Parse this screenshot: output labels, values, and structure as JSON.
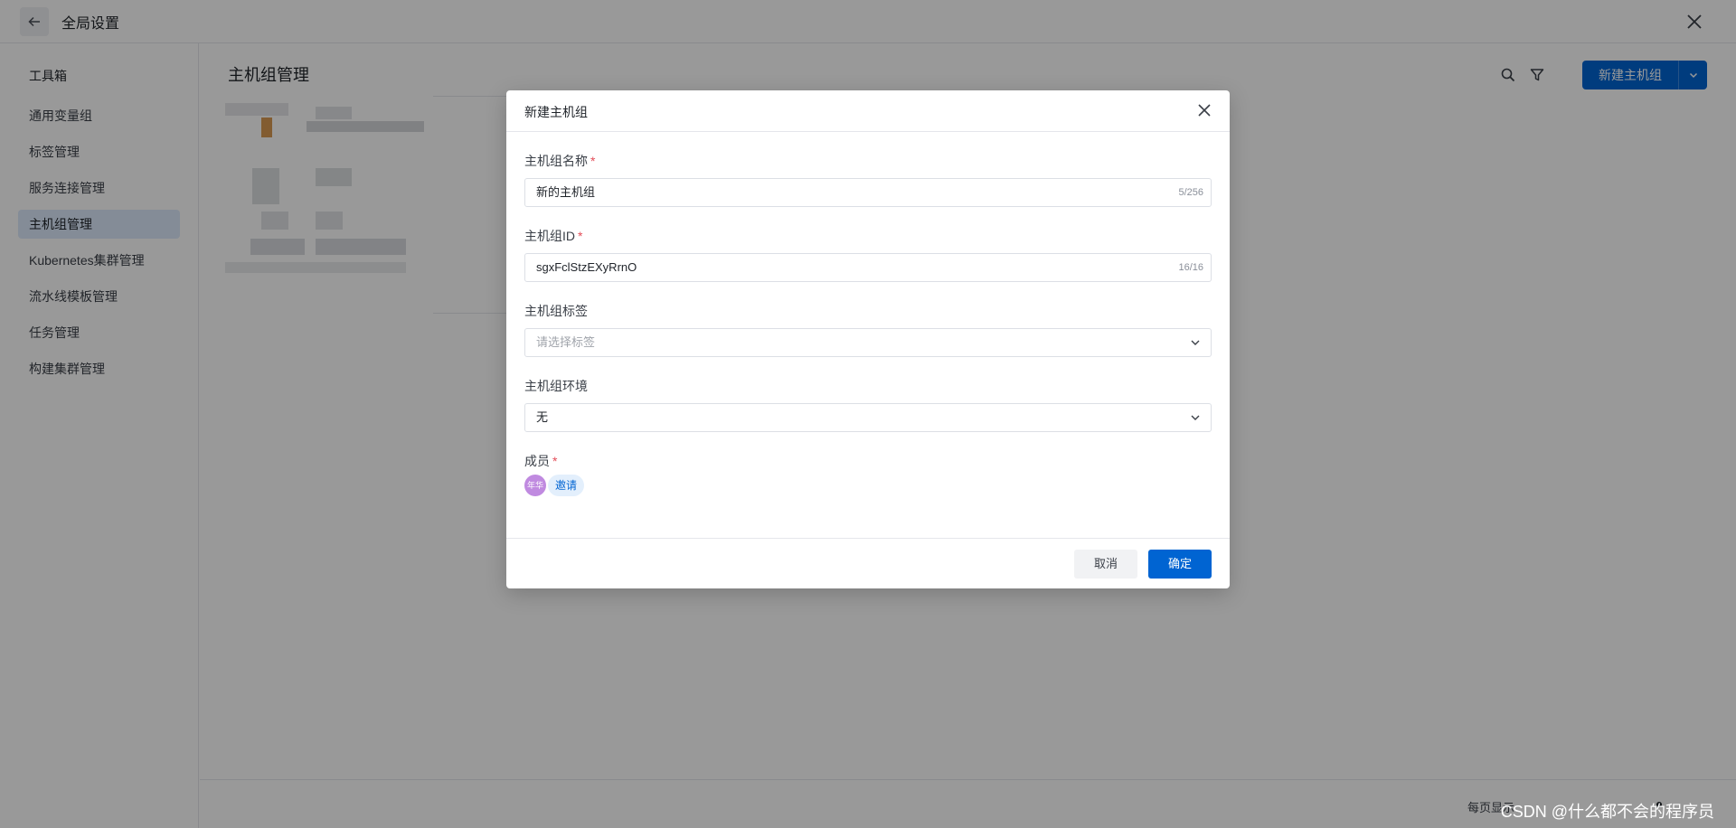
{
  "header": {
    "title": "全局设置"
  },
  "sidebar": {
    "heading": "工具箱",
    "items": [
      {
        "label": "通用变量组",
        "active": false
      },
      {
        "label": "标签管理",
        "active": false
      },
      {
        "label": "服务连接管理",
        "active": false
      },
      {
        "label": "主机组管理",
        "active": true
      },
      {
        "label": "Kubernetes集群管理",
        "active": false
      },
      {
        "label": "流水线模板管理",
        "active": false
      },
      {
        "label": "任务管理",
        "active": false
      },
      {
        "label": "构建集群管理",
        "active": false
      }
    ]
  },
  "main": {
    "title": "主机组管理",
    "new_button_label": "新建主机组",
    "footer": {
      "page_size_label": "每页显示"
    }
  },
  "modal": {
    "title": "新建主机组",
    "name_field": {
      "label": "主机组名称",
      "value": "新的主机组",
      "counter": "5/256"
    },
    "id_field": {
      "label": "主机组ID",
      "value": "sgxFclStzEXyRrnO",
      "counter": "16/16"
    },
    "tags_field": {
      "label": "主机组标签",
      "placeholder": "请选择标签"
    },
    "env_field": {
      "label": "主机组环境",
      "value": "无"
    },
    "members": {
      "label": "成员",
      "avatar_text": "年华",
      "invite_label": "邀请"
    },
    "cancel_label": "取消",
    "ok_label": "确定"
  },
  "watermark": "CSDN @什么都不会的程序员",
  "colors": {
    "primary": "#0064d2",
    "required": "#e34d59",
    "active_nav": "#dceafc"
  }
}
